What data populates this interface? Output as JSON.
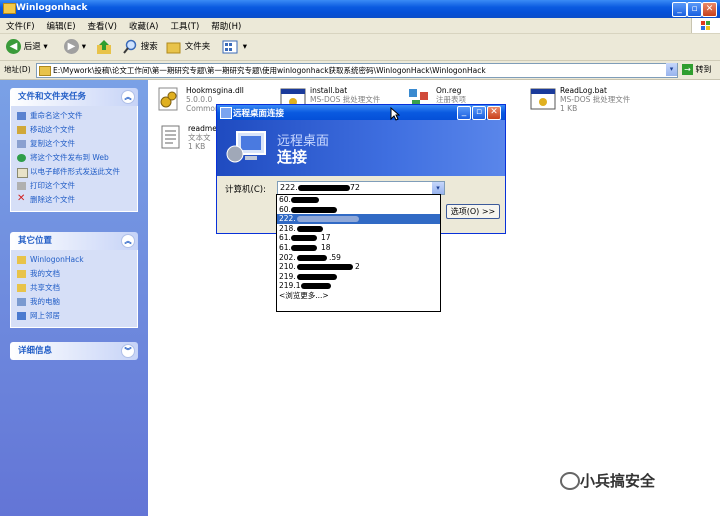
{
  "window": {
    "title": "Winlogonhack"
  },
  "menu": [
    "文件(F)",
    "编辑(E)",
    "查看(V)",
    "收藏(A)",
    "工具(T)",
    "帮助(H)"
  ],
  "toolbar": {
    "back": "后退",
    "search": "搜索",
    "folders": "文件夹"
  },
  "address": {
    "label": "地址(D)",
    "value": "E:\\Mywork\\投稿\\论文工作间\\第一期研究专题\\第一期研究专题\\使用winlogonhack获取系统密码\\WinlogonHack\\WinlogonHack",
    "go": "转到"
  },
  "left_pane": {
    "tasks": {
      "title": "文件和文件夹任务",
      "items": [
        "重命名这个文件",
        "移动这个文件",
        "复制这个文件",
        "将这个文件发布到 Web",
        "以电子邮件形式发送此文件",
        "打印这个文件",
        "删除这个文件"
      ]
    },
    "places": {
      "title": "其它位置",
      "items": [
        "WinlogonHack",
        "我的文档",
        "共享文档",
        "我的电脑",
        "网上邻居"
      ]
    },
    "details": {
      "title": "详细信息"
    }
  },
  "files": [
    {
      "name": "Hookmsgina.dll",
      "l2": "5.0.0.0",
      "l3": "Common",
      "icon": "dll-gear-icon"
    },
    {
      "name": "install.bat",
      "l2": "MS-DOS 批处理文件",
      "l3": "",
      "icon": "batch-icon"
    },
    {
      "name": "On.reg",
      "l2": "注册表项",
      "l3": "",
      "icon": "registry-icon"
    },
    {
      "name": "ReadLog.bat",
      "l2": "MS-DOS 批处理文件",
      "l3": "1 KB",
      "icon": "batch-icon"
    },
    {
      "name": "readme",
      "l2": "文本文",
      "l3": "1 KB",
      "icon": "text-file-icon"
    }
  ],
  "dialog": {
    "title": "远程桌面连接",
    "banner_line1": "远程桌面",
    "banner_line2": "连接",
    "computer_label": "计算机(C):",
    "computer_value": "222.",
    "computer_value_suffix": "72",
    "options_button": "选项(O) >>",
    "dropdown": [
      {
        "text": "60."
      },
      {
        "text": "60."
      },
      {
        "text": "222."
      },
      {
        "text": "218."
      },
      {
        "text": "61.",
        "suffix": "17"
      },
      {
        "text": "61.",
        "suffix": "18"
      },
      {
        "text": "202.",
        "suffix": ".59"
      },
      {
        "text": "210.",
        "suffix": "2"
      },
      {
        "text": "219."
      },
      {
        "text": "219.1"
      },
      {
        "text": "<浏览更多...>"
      }
    ]
  },
  "watermark": "小兵搞安全"
}
